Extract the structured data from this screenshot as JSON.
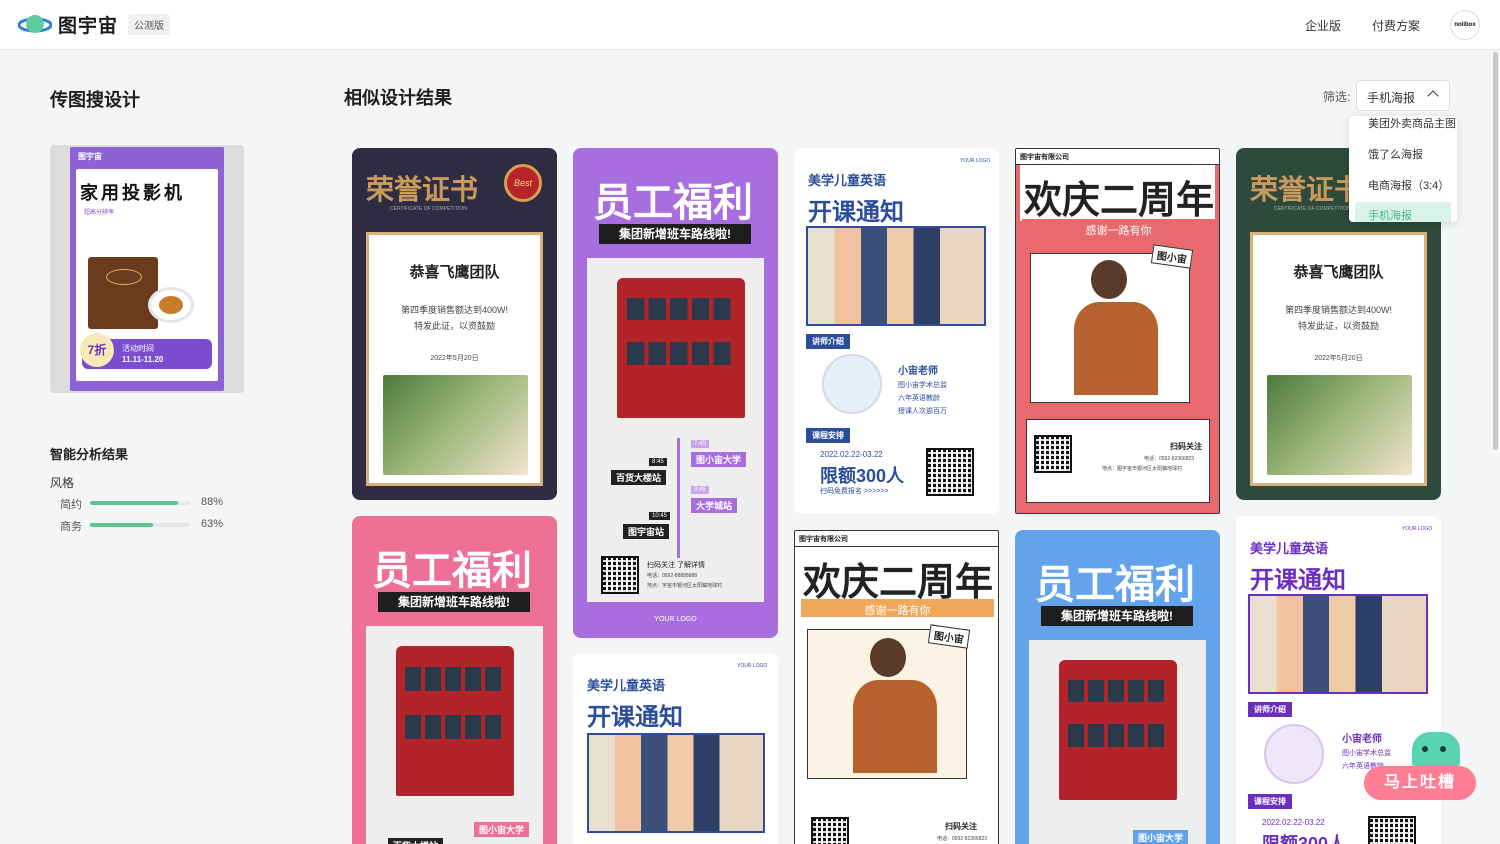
{
  "header": {
    "logo_text": "图宇宙",
    "beta_badge": "公测版",
    "nav": [
      "企业版",
      "付费方案"
    ],
    "avatar_text": "nolibox"
  },
  "left": {
    "title": "传图搜设计",
    "upload_poster": {
      "brand": "图宇宙",
      "headline": "家用投影机",
      "sub": "超高分辨率",
      "discount": "7折",
      "event_label": "活动时间",
      "event_dates": "11.11-11.20"
    },
    "analysis_title": "智能分析结果",
    "style_label": "风格",
    "metrics": [
      {
        "name": "简约",
        "value": 88,
        "label": "88%"
      },
      {
        "name": "商务",
        "value": 63,
        "label": "63%"
      }
    ],
    "accent": "#5cc492"
  },
  "results": {
    "title": "相似设计结果",
    "filter_label": "筛选:",
    "filter_value": "手机海报",
    "dropdown": [
      "美团外卖商品主图",
      "饿了么海报",
      "电商海报（3:4）",
      "手机海报"
    ]
  },
  "cards": {
    "honor": {
      "title": "荣誉证书",
      "sub": "CERTIFICATE OF COMPETITION",
      "badge": "Best",
      "team": "恭喜飞鹰团队",
      "line1": "第四季度销售额达到400W!",
      "line2": "特发此证，以资鼓励",
      "date": "2022年5月20日"
    },
    "welfare": {
      "title": "员工福利",
      "ribbon": "集团新增班车路线啦!",
      "stops": [
        "图小宙大学",
        "百货大楼站",
        "大学城站",
        "图宇宙站"
      ],
      "times": [
        "7:45",
        "8:45",
        "9:45",
        "10:45"
      ],
      "scan": "扫码关注 了解详情",
      "phone": "电话：0592-88888888",
      "addr": "地点：宇宙市银河区太阳镇地球村",
      "logo": "YOUR LOGO"
    },
    "english": {
      "brand": "美学儿童英语",
      "title": "开课通知",
      "logo": "YOUR LOGO",
      "section1": "讲师介绍",
      "teacher": "小宙老师",
      "items": [
        "图小宙学术总监",
        "六年英语教龄",
        "授课人次逾百万"
      ],
      "section2": "课程安排",
      "dates": "2022.02.22-03.22",
      "limit": "限额300人",
      "cta": "扫码免费报名 >>>>>>"
    },
    "anniv": {
      "company": "图宇宙有限公司",
      "title": "欢庆二周年",
      "sub": "感谢一路有你",
      "tag": "图小宙",
      "scan": "扫码关注",
      "phone": "电话：0592-82366823",
      "addr": "地点：图宇宙市银河区太阳镇地球村"
    }
  },
  "feedback": "马上吐槽",
  "colors": {
    "honor_dark": "#2e2d44",
    "honor_green": "#2e4a3d",
    "honor_title": "#c99a5b",
    "welfare_purple": "#a86ee0",
    "welfare_pink": "#ee7096",
    "welfare_blue": "#63a3ec",
    "anniv_red": "#e86a6e",
    "anniv_orange": "#f0a75a",
    "english_blue": "#2c4e9a"
  }
}
